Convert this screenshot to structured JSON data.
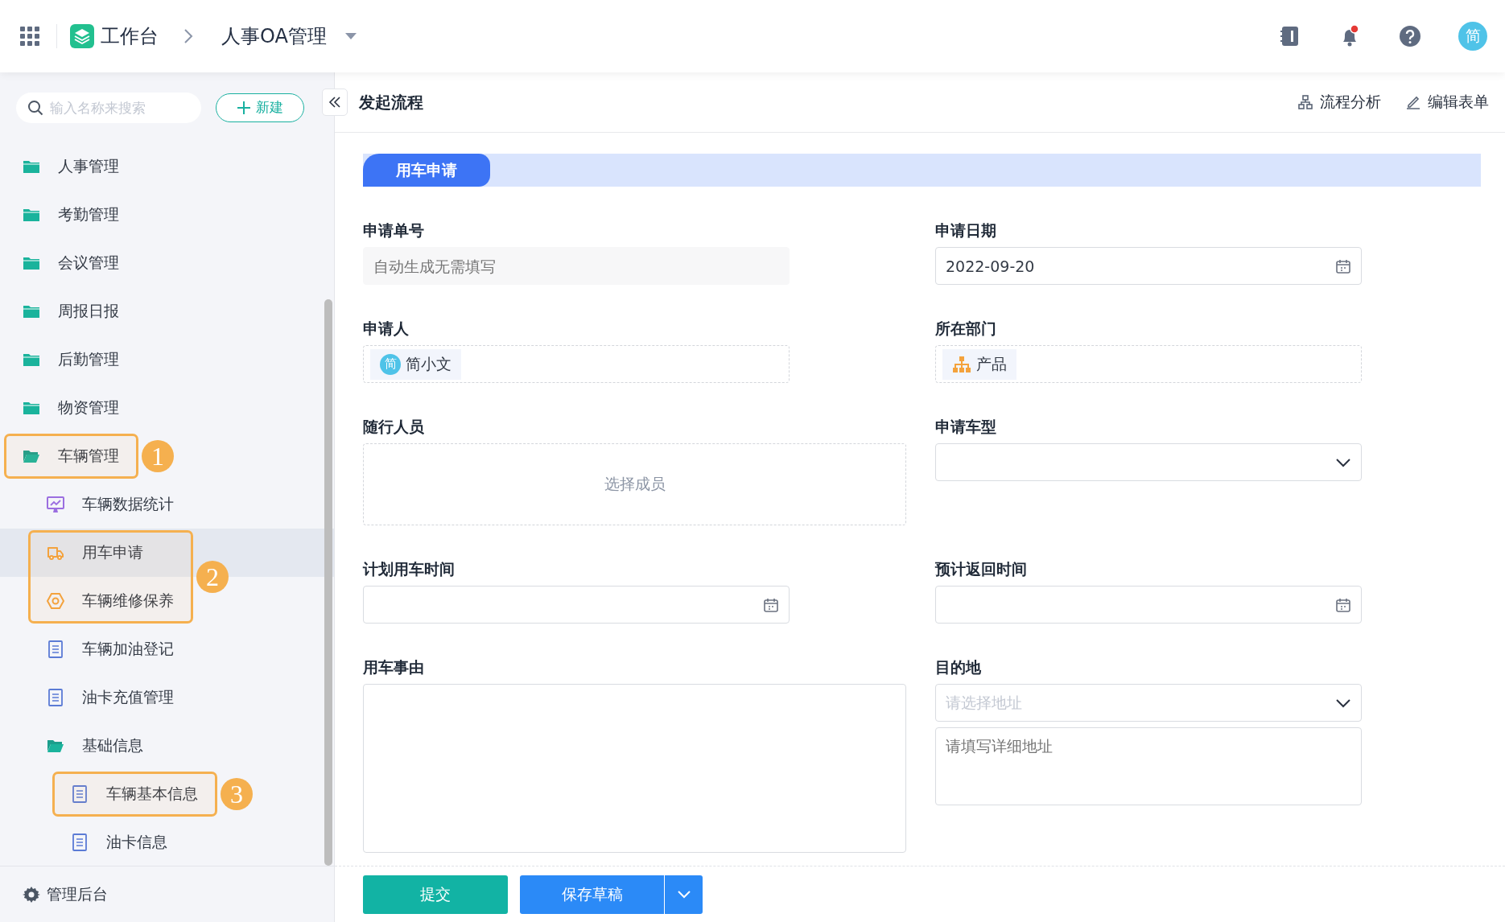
{
  "topbar": {
    "app_title": "工作台",
    "breadcrumb": "人事OA管理",
    "avatar": "简"
  },
  "sidebar": {
    "search": {
      "placeholder": "输入名称来搜索"
    },
    "new_button": "新建",
    "items": [
      {
        "label": "人事管理",
        "kind": "folder",
        "expanded": false,
        "selected": false
      },
      {
        "label": "考勤管理",
        "kind": "folder",
        "expanded": false,
        "selected": false
      },
      {
        "label": "会议管理",
        "kind": "folder",
        "expanded": false,
        "selected": false
      },
      {
        "label": "周报日报",
        "kind": "folder",
        "expanded": false,
        "selected": false
      },
      {
        "label": "后勤管理",
        "kind": "folder",
        "expanded": false,
        "selected": false
      },
      {
        "label": "物资管理",
        "kind": "folder",
        "expanded": false,
        "selected": false
      },
      {
        "label": "车辆管理",
        "kind": "folder",
        "expanded": true,
        "selected": false,
        "annotation": "1",
        "children": [
          {
            "label": "车辆数据统计",
            "kind": "dashboard",
            "selected": false
          },
          {
            "label": "用车申请",
            "kind": "vehicle_form",
            "selected": true,
            "annotation": "2"
          },
          {
            "label": "车辆维修保养",
            "kind": "maintenance_form",
            "selected": false,
            "in_previous_annotation": true
          },
          {
            "label": "车辆加油登记",
            "kind": "form",
            "selected": false
          },
          {
            "label": "油卡充值管理",
            "kind": "form",
            "selected": false
          },
          {
            "label": "基础信息",
            "kind": "folder",
            "expanded": true,
            "selected": false,
            "children": [
              {
                "label": "车辆基本信息",
                "kind": "form",
                "selected": false,
                "annotation": "3"
              },
              {
                "label": "油卡信息",
                "kind": "form",
                "selected": false
              }
            ]
          }
        ]
      }
    ],
    "footer": "管理后台"
  },
  "main": {
    "title": "发起流程",
    "actions": [
      {
        "label": "流程分析",
        "kind": "analysis"
      },
      {
        "label": "编辑表单",
        "kind": "edit"
      }
    ],
    "section": "用车申请",
    "rows": [
      [
        {
          "label": "申请单号",
          "kind": "readonly",
          "placeholder": "自动生成无需填写"
        },
        {
          "label": "申请日期",
          "kind": "date",
          "value": "2022-09-20"
        }
      ],
      [
        {
          "label": "申请人",
          "kind": "user",
          "avatar": "简",
          "value": "简小文"
        },
        {
          "label": "所在部门",
          "kind": "department",
          "value": "产品"
        }
      ],
      [
        {
          "label": "随行人员",
          "kind": "member_picker",
          "action": "选择成员"
        },
        {
          "label": "申请车型",
          "kind": "select"
        }
      ],
      [
        {
          "label": "计划用车时间",
          "kind": "date"
        },
        {
          "label": "预计返回时间",
          "kind": "date"
        }
      ],
      [
        {
          "label": "用车事由",
          "kind": "textarea"
        },
        {
          "label": "目的地",
          "kind": "address",
          "placeholder": "请选择地址",
          "detail_placeholder": "请填写详细地址"
        }
      ]
    ],
    "submit": "提交",
    "save_draft": "保存草稿"
  }
}
